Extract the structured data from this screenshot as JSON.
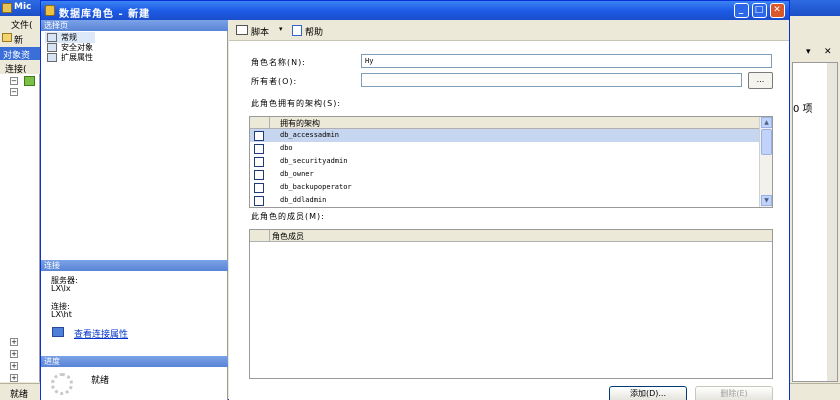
{
  "background_app": {
    "title": "Mic",
    "menu_file": "文件(",
    "toolbar_new": "新",
    "explorer_title": "对象资",
    "connect_label": "连接(",
    "status_text": "就绪",
    "item_count": "0 项"
  },
  "dialog": {
    "title": "数据库角色 - 新建",
    "minimize": "_",
    "maximize": "□",
    "close": "✕",
    "left_pane": {
      "select_page_header": "选择页",
      "pages": [
        "常规",
        "安全对象",
        "扩展属性"
      ],
      "connection_header": "连接",
      "server_label": "服务器:",
      "server_value": "LX\\lx",
      "connection_label": "连接:",
      "connection_value": "LX\\ht",
      "view_connection_link": "查看连接属性",
      "progress_header": "进度",
      "progress_status": "就绪"
    },
    "toolbar": {
      "script_label": "脚本",
      "script_dropdown": "▾",
      "help_label": "帮助"
    },
    "form": {
      "role_name_label": "角色名称(N):",
      "role_name_value": "Hy",
      "owner_label": "所有者(O):",
      "owner_value": "",
      "browse_button": "...",
      "schemas_label": "此角色拥有的架构(S):",
      "schemas_header": "拥有的架构",
      "schemas": [
        "db_accessadmin",
        "dbo",
        "db_securityadmin",
        "db_owner",
        "db_backupoperator",
        "db_ddladmin"
      ],
      "members_label": "此角色的成员(M):",
      "members_header": "角色成员",
      "add_button": "添加(D)...",
      "remove_button": "删除(E)"
    }
  }
}
